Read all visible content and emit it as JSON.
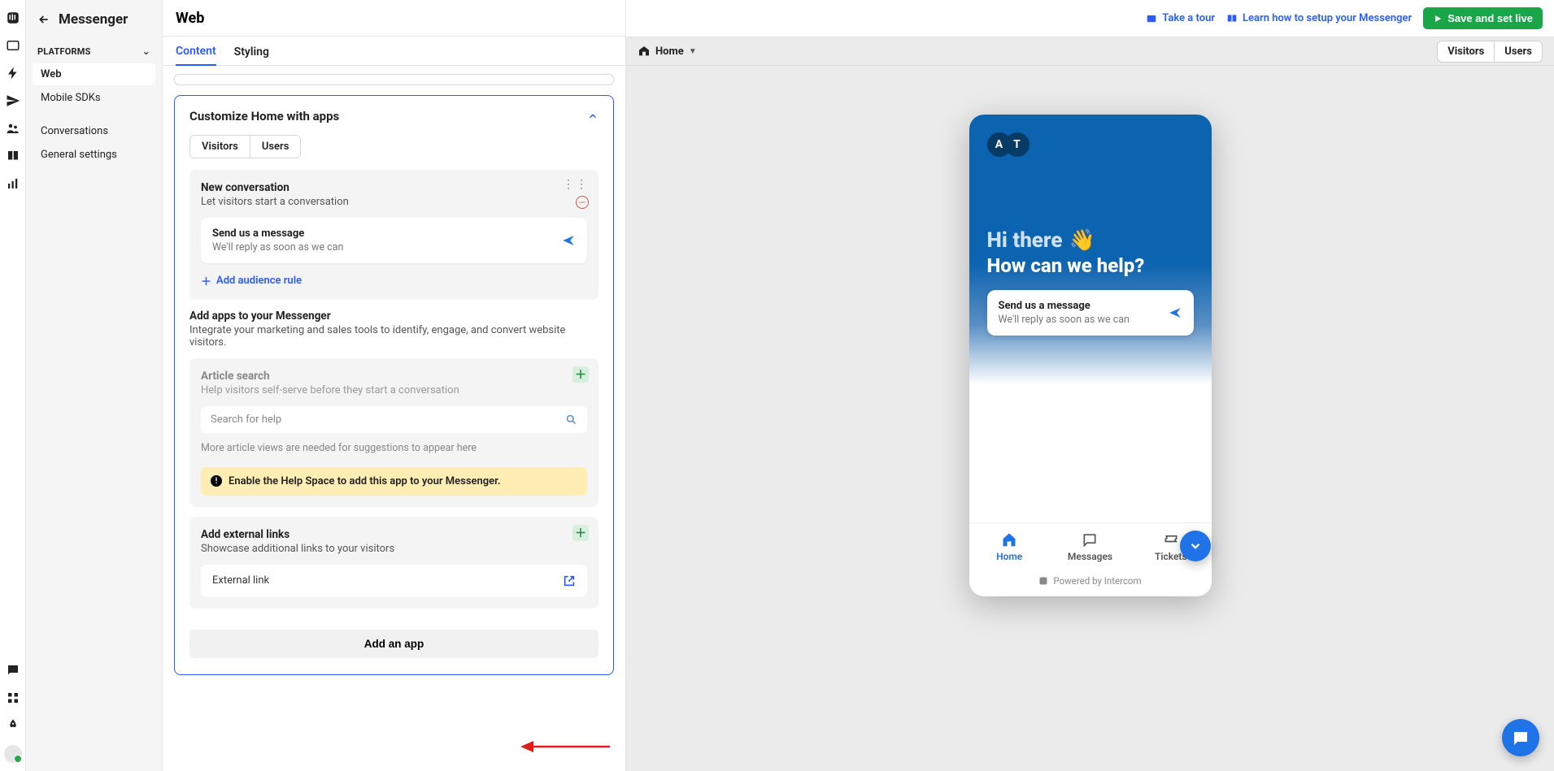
{
  "app": {
    "title": "Messenger"
  },
  "sidebar": {
    "section_label": "PLATFORMS",
    "items": [
      "Web",
      "Mobile SDKs"
    ],
    "secondary": [
      "Conversations",
      "General settings"
    ]
  },
  "header": {
    "title": "Web",
    "tour": "Take a tour",
    "learn": "Learn how to setup your Messenger",
    "save": "Save and set live"
  },
  "tabs": {
    "content": "Content",
    "styling": "Styling"
  },
  "homeCard": {
    "title": "Customize Home with apps",
    "seg": {
      "visitors": "Visitors",
      "users": "Users"
    },
    "newConvo": {
      "title": "New conversation",
      "sub": "Let visitors start a conversation",
      "msgTitle": "Send us a message",
      "msgSub": "We'll reply as soon as we can",
      "addRule": "Add audience rule"
    },
    "addApps": {
      "title": "Add apps to your Messenger",
      "sub": "Integrate your marketing and sales tools to identify, engage, and convert website visitors."
    },
    "articleSearch": {
      "title": "Article search",
      "sub": "Help visitors self-serve before they start a conversation",
      "placeholder": "Search for help",
      "hint": "More article views are needed for suggestions to appear here",
      "warning": "Enable the Help Space to add this app to your Messenger."
    },
    "externalLinks": {
      "title": "Add external links",
      "sub": "Showcase additional links to your visitors",
      "item": "External link"
    },
    "addApp": "Add an app"
  },
  "preview": {
    "toolbar": {
      "view": "Home",
      "seg": {
        "visitors": "Visitors",
        "users": "Users"
      }
    },
    "messenger": {
      "avatars": [
        "A",
        "T"
      ],
      "hi": "Hi there",
      "question": "How can we help?",
      "card": {
        "title": "Send us a message",
        "sub": "We'll reply as soon as we can"
      },
      "nav": {
        "home": "Home",
        "messages": "Messages",
        "tickets": "Tickets"
      },
      "footer": "Powered by Intercom"
    }
  }
}
